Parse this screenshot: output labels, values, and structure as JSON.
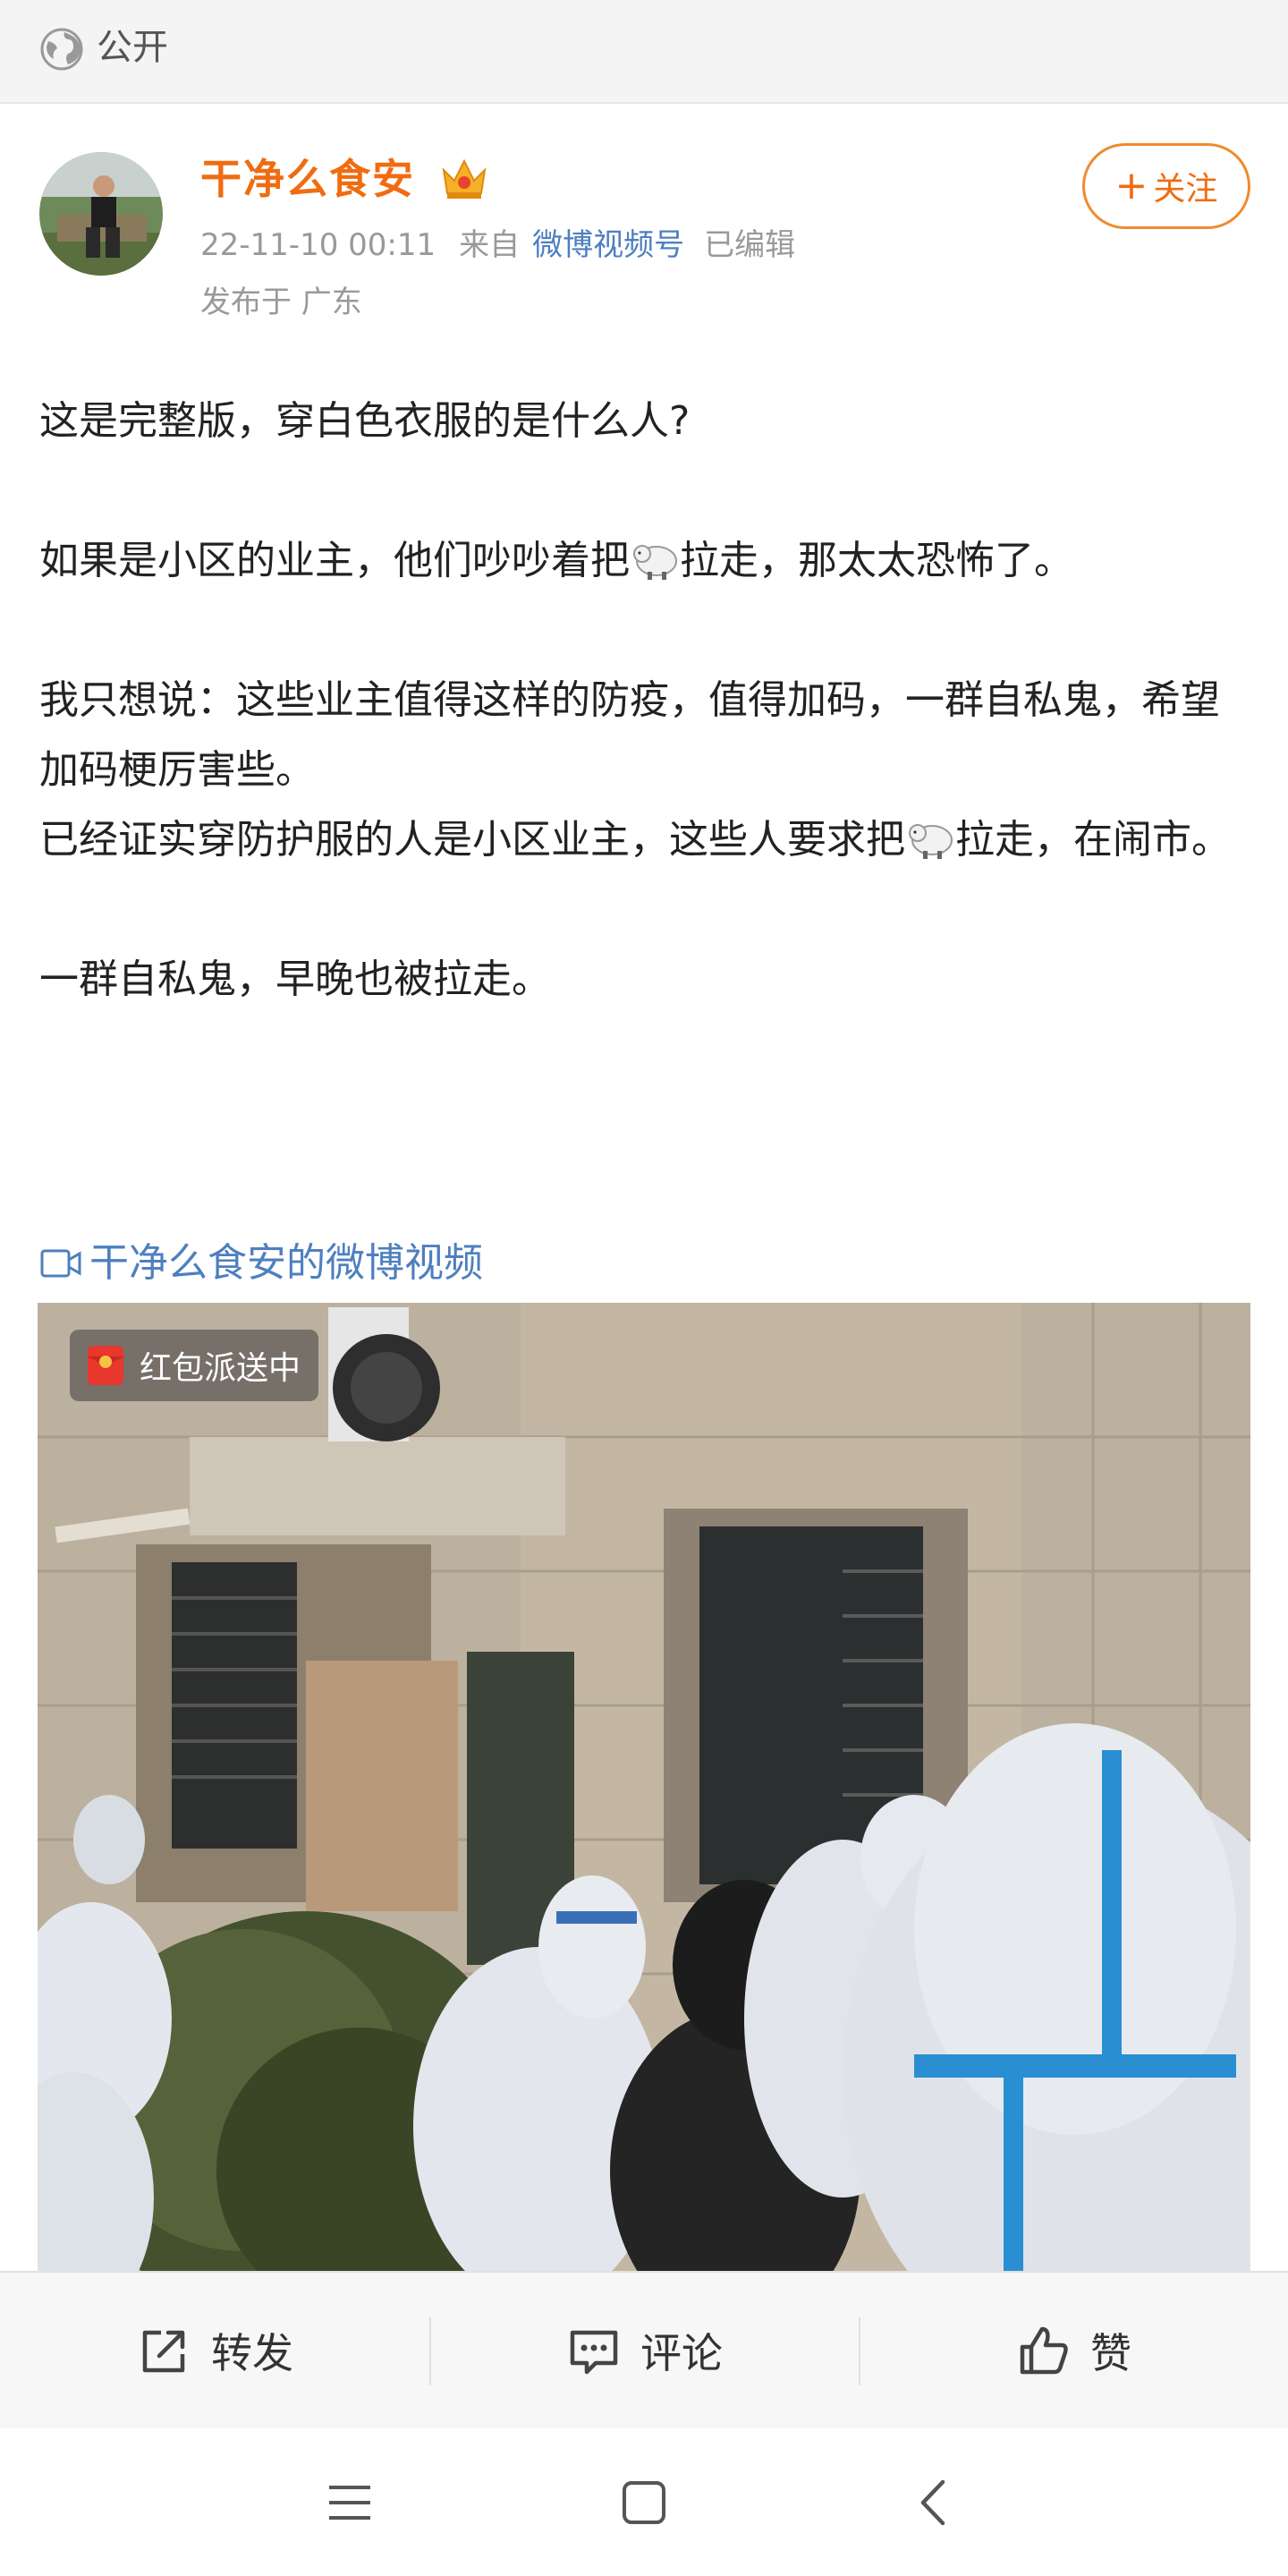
{
  "visibility": {
    "label": "公开",
    "icon": "globe-icon"
  },
  "author": {
    "name": "干净么食安",
    "badge_icon": "crown-icon",
    "timestamp": "22-11-10 00:11",
    "from_prefix": "来自",
    "source": "微博视频号",
    "edited": "已编辑",
    "location": "发布于 广东",
    "follow_label": "关注"
  },
  "post": {
    "line1": "这是完整版，穿白色衣服的是什么人?",
    "line2_a": "如果是小区的业主，他们吵吵着把",
    "line2_b": "拉走，那太太恐怖了。",
    "line3": "我只想说：这些业主值得这样的防疫，值得加码，一群自私鬼，希望加码梗厉害些。",
    "line4_a": "已经证实穿防护服的人是小区业主，这些人要求把",
    "line4_b": "拉走，在闹市。",
    "line5": "一群自私鬼，早晚也被拉走。",
    "emoji_icon": "sheep-emoji-icon"
  },
  "video": {
    "link_label": "干净么食安的微博视频",
    "badge_label": "红包派送中"
  },
  "actions": {
    "repost": "转发",
    "comment": "评论",
    "like": "赞"
  },
  "colors": {
    "author_name": "#f06c11",
    "link": "#4e7fbf",
    "follow_border": "#f08a2e"
  }
}
